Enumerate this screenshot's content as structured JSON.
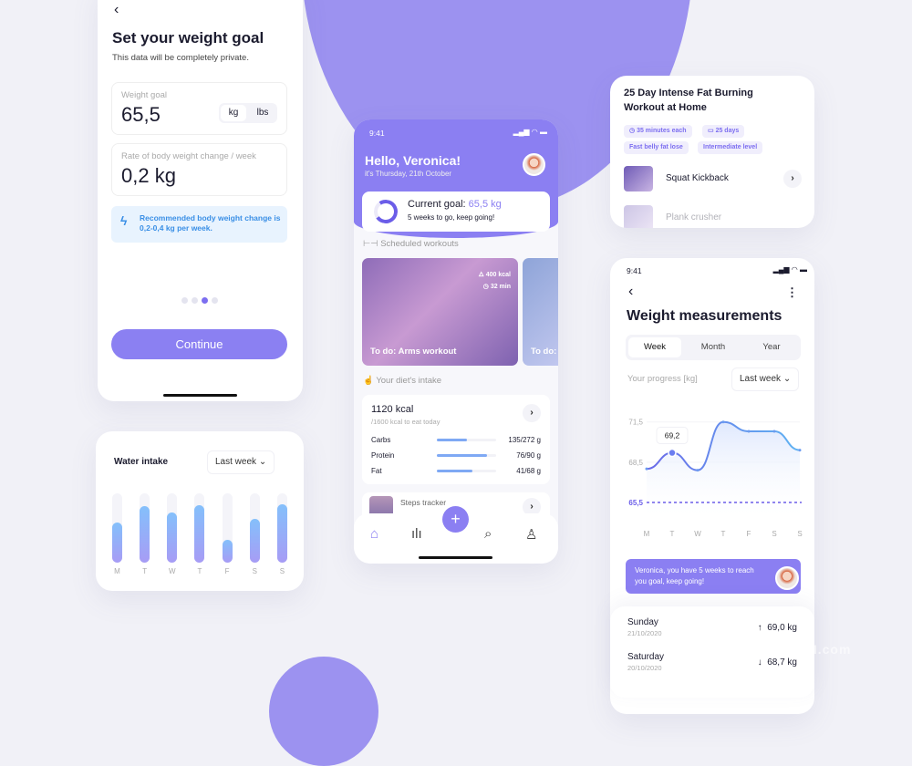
{
  "goal_screen": {
    "back_icon": "chevron-left",
    "title": "Set your weight goal",
    "subtitle": "This data will be completely private.",
    "weight_goal": {
      "label": "Weight goal",
      "value": "65,5",
      "units": [
        "kg",
        "lbs"
      ],
      "selected_unit": "kg"
    },
    "rate": {
      "label": "Rate of body weight change / week",
      "value": "0,2 kg"
    },
    "recommendation": {
      "icon": "lightning-icon",
      "text": "Recommended body weight change is 0,2-0,4 kg per week."
    },
    "pagination": {
      "total": 4,
      "active": 3
    },
    "continue_label": "Continue"
  },
  "water": {
    "title": "Water intake",
    "range": "Last week",
    "days": [
      "M",
      "T",
      "W",
      "T",
      "F",
      "S",
      "S"
    ],
    "fill_fraction": [
      0.58,
      0.81,
      0.73,
      0.83,
      0.33,
      0.63,
      0.84
    ]
  },
  "home": {
    "time": "9:41",
    "greeting": "Hello, Veronica!",
    "date": "it's Thursday, 21th October",
    "goal": {
      "label": "Current goal:",
      "value": "65,5 kg",
      "sub": "5 weeks to go, keep going!",
      "progress": 0.72
    },
    "scheduled_title": "Scheduled workouts",
    "workouts": [
      {
        "caption": "To do: Arms workout",
        "kcal": "400 kcal",
        "time": "32 min"
      },
      {
        "caption": "To do:"
      }
    ],
    "diet_title": "Your diet's intake",
    "kcal": "1120 kcal",
    "kcal_sub": "/1600 kcal to eat today",
    "macros": [
      {
        "name": "Carbs",
        "value": "135/272 g",
        "fraction": 0.5
      },
      {
        "name": "Protein",
        "value": "76/90 g",
        "fraction": 0.84
      },
      {
        "name": "Fat",
        "value": "41/68 g",
        "fraction": 0.6
      }
    ],
    "steps_label": "Steps tracker",
    "nav": [
      "home-icon",
      "stats-icon",
      "add-icon",
      "search-icon",
      "profile-icon"
    ]
  },
  "plan": {
    "title": "25 Day Intense Fat Burning Workout at Home",
    "tags": [
      "35 minutes each",
      "25 days",
      "Fast belly fat lose",
      "Intermediate level"
    ],
    "exercises": [
      "Squat Kickback",
      "Plank crusher"
    ]
  },
  "weight": {
    "time": "9:41",
    "title": "Weight measurements",
    "tabs": [
      "Week",
      "Month",
      "Year"
    ],
    "active_tab": "Week",
    "progress_label": "Your progress [kg]",
    "range": "Last week",
    "message": "Veronica, you have 5 weeks to reach you goal, keep going!",
    "history": [
      {
        "day": "Sunday",
        "date": "21/10/2020",
        "direction": "up",
        "value": "69,0 kg"
      },
      {
        "day": "Saturday",
        "date": "20/10/2020",
        "direction": "down",
        "value": "68,7 kg"
      }
    ]
  },
  "chart_data": {
    "type": "line",
    "title": "Your progress [kg]",
    "categories": [
      "M",
      "T",
      "W",
      "T",
      "F",
      "S",
      "S"
    ],
    "values": [
      68.0,
      69.2,
      67.9,
      71.5,
      70.8,
      70.8,
      69.4
    ],
    "y_ticks": [
      "71,5",
      "68,5",
      "65,5"
    ],
    "ylim": [
      64.0,
      72.5
    ],
    "goal_line": {
      "value": 65.5,
      "label": "65,5"
    },
    "highlight": {
      "index": 1,
      "label": "69,2"
    },
    "grid": true
  },
  "watermark": "TOOOPEN.com"
}
